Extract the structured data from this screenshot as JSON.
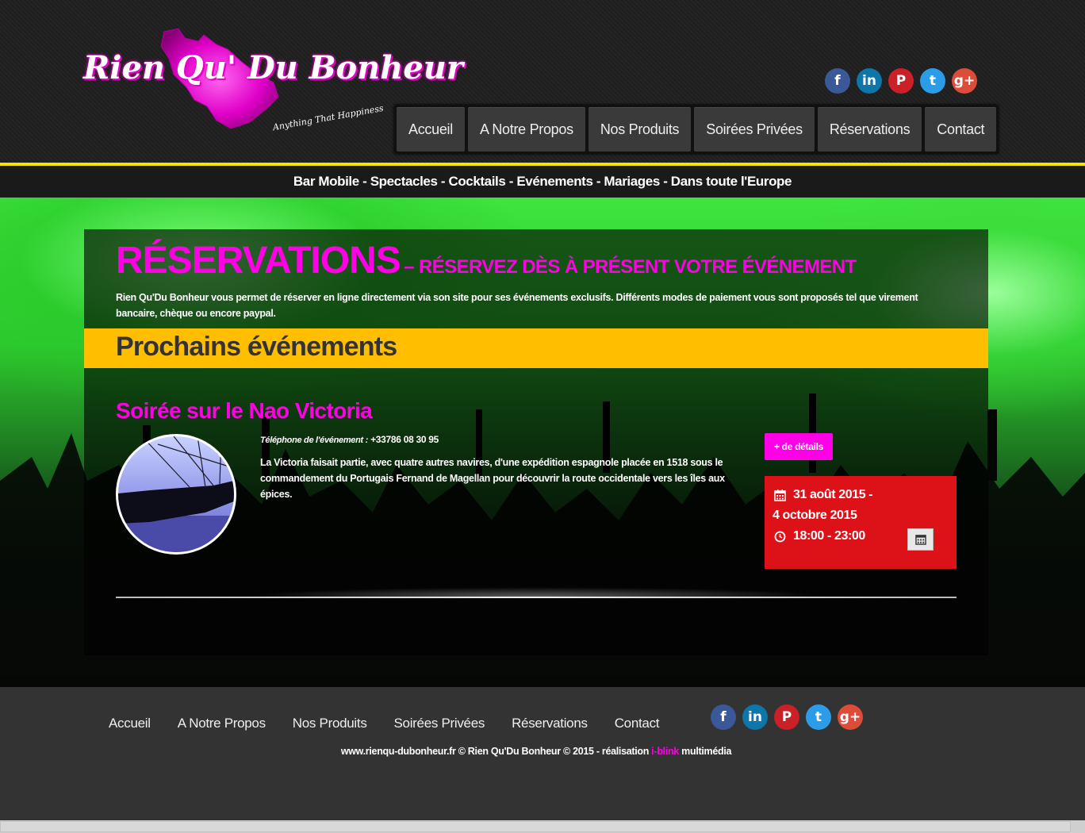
{
  "logo": {
    "text": "Rien Qu' Du Bonheur",
    "tagline": "Anything That Happiness"
  },
  "social": [
    {
      "name": "facebook",
      "glyph": "f"
    },
    {
      "name": "linkedin",
      "glyph": "in"
    },
    {
      "name": "pinterest",
      "glyph": "P"
    },
    {
      "name": "twitter",
      "glyph": "t"
    },
    {
      "name": "google-plus",
      "glyph": "g+"
    }
  ],
  "nav": {
    "items": [
      "Accueil",
      "A Notre Propos",
      "Nos Produits",
      "Soirées Privées",
      "Réservations",
      "Contact"
    ]
  },
  "tagline": "Bar Mobile - Spectacles - Cocktails - Evénements - Mariages - Dans toute l'Europe",
  "page": {
    "title": "RÉSERVATIONS",
    "subtitle": "– RÉSERVEZ DÈS À PRÉSENT VOTRE ÉVÉNEMENT",
    "intro": "Rien Qu'Du Bonheur vous permet de réserver en ligne directement via son site pour ses événements exclusifs. Différents modes de paiement vous sont proposés tel que virement bancaire, chèque ou encore paypal.",
    "section_heading": "Prochains événements"
  },
  "event": {
    "title": "Soirée sur le Nao Victoria",
    "phone_label": "Téléphone de l'événement :",
    "phone": "+33786 08 30 95",
    "description": "La Victoria faisait partie, avec quatre autres navires, d'une expédition espagnole placée en 1518 sous le commandement du Portugais Fernand de Magellan pour découvrir la route occidentale vers les îles aux épices.",
    "details_button": "+ de détails",
    "date_start": "31 août 2015 -",
    "date_end": "4 octobre 2015",
    "time": "18:00 - 23:00"
  },
  "footer": {
    "links": [
      "Accueil",
      "A Notre Propos",
      "Nos Produits",
      "Soirées Privées",
      "Réservations",
      "Contact"
    ],
    "copyright_prefix": "www.rienqu-dubonheur.fr © Rien Qu'Du Bonheur © 2015 - réalisation ",
    "copyright_brand": "i-blink",
    "copyright_suffix": " multimédia"
  },
  "colors": {
    "accent_magenta": "#ff00e6",
    "yellow_band": "#ffbf00",
    "date_box_red": "#dd1219",
    "header_yellow_line": "#f4e400"
  }
}
